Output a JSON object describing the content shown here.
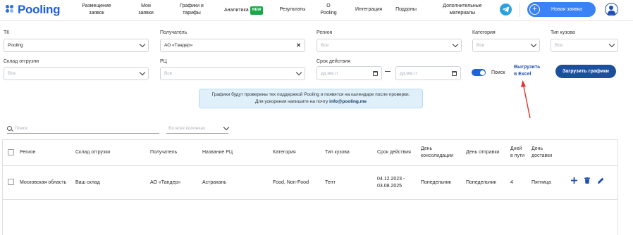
{
  "brand": {
    "name": "Pooling",
    "color": "#1f5fd6"
  },
  "nav": [
    {
      "label": "Размещение\nзаявок"
    },
    {
      "label": "Мои\nзаявки"
    },
    {
      "label": "Графики и\nтарифы"
    },
    {
      "label": "Аналитика",
      "badge": "NEW"
    },
    {
      "label": "Результаты"
    },
    {
      "label": "О\nPooling"
    },
    {
      "label": "Интеграция"
    },
    {
      "label": "Поддоны"
    },
    {
      "label": "Дополнительные\nматериалы"
    }
  ],
  "header": {
    "new_request_label": "Новая заявка",
    "telegram_icon": "telegram-icon",
    "user_icon": "user-icon"
  },
  "filters": {
    "tk": {
      "label": "ТК",
      "value": "Pooling"
    },
    "receiver": {
      "label": "Получатель",
      "value": "АО «Тандер»"
    },
    "region": {
      "label": "Регион",
      "placeholder": "Все"
    },
    "category": {
      "label": "Категория",
      "placeholder": "Все"
    },
    "body_type": {
      "label": "Тип кузова",
      "placeholder": "Все"
    },
    "warehouse": {
      "label": "Склад отгрузни",
      "placeholder": "Все"
    },
    "rc": {
      "label": "РЦ",
      "placeholder": "Все"
    },
    "validity": {
      "label": "Срок действия",
      "from_placeholder": "дд.мм.гг",
      "to_placeholder": "дд.мм.гг"
    },
    "search_toggle": {
      "label": "Поиск",
      "on": true
    },
    "export_link": "Выгрузить\nв Excel",
    "upload_button": "Загрузить графики"
  },
  "info": {
    "line1": "Графики будут проверены тех поддержкой Pooling и появятся на календаре после проверки.",
    "line2_prefix": "Для ускорения напишите на почту ",
    "email": "info@pooling.me"
  },
  "search": {
    "placeholder": "Поиск",
    "columns_placeholder": "Во всех колонках"
  },
  "table": {
    "headers": [
      "Регион",
      "Склад отгрузки",
      "Получатель",
      "Название РЦ",
      "Категория",
      "Тип кузова",
      "Срок действия",
      "День\nконсолидации",
      "День отправки",
      "Дней\nв пути",
      "День\nдоставки"
    ],
    "rows": [
      [
        "Московская область",
        "Ваш склад",
        "АО «Тандер»",
        "Астрахань",
        "Food, Non-Food",
        "Тент",
        "04.12.2023 -\n03.08.2025",
        "Понедельник",
        "Понедельник",
        "4",
        "Пятница"
      ]
    ]
  },
  "colors": {
    "accent": "#3a82f6",
    "dark_button": "#1c4f9c",
    "annotation_arrow": "#e0332f"
  }
}
